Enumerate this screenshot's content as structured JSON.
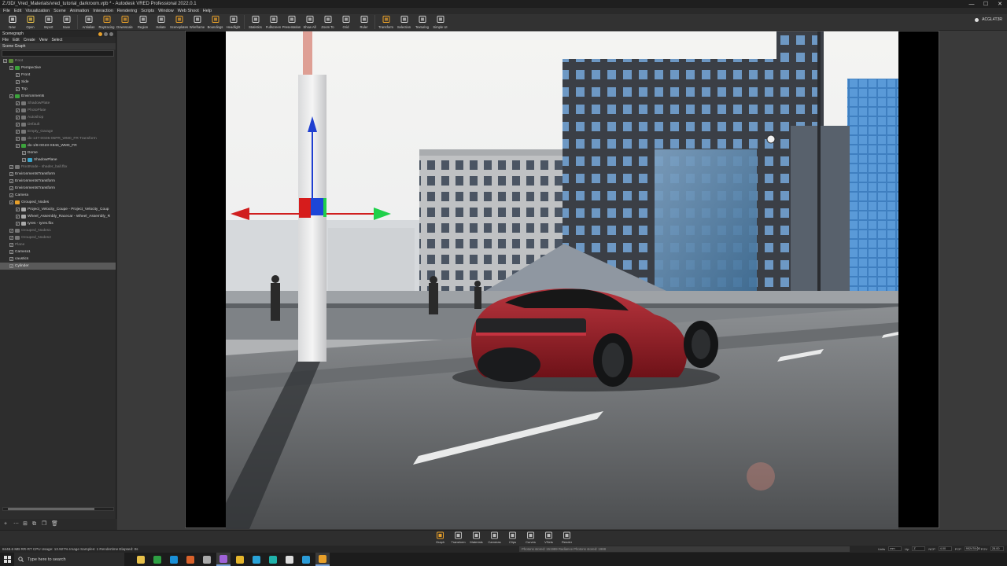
{
  "window": {
    "title": "Z:/3D/_Vred_Materials/vred_tutorial_darkroom.vpb * - Autodesk VRED Professional 2022.0.1",
    "controls": [
      "—",
      "☐",
      "✕"
    ]
  },
  "menubar": [
    "File",
    "Edit",
    "Visualization",
    "Scene",
    "Animation",
    "Interaction",
    "Rendering",
    "Scripts",
    "Window",
    "Web Shoot",
    "Help"
  ],
  "toolbar": {
    "items": [
      {
        "label": "New",
        "icon": "new-file-icon"
      },
      {
        "label": "Open",
        "icon": "open-folder-icon"
      },
      {
        "label": "Import",
        "icon": "import-icon"
      },
      {
        "label": "Save",
        "icon": "save-icon"
      },
      {
        "label": "Antialias",
        "icon": "antialias-icon"
      },
      {
        "label": "Raytracing",
        "icon": "raytracing-icon"
      },
      {
        "label": "Downscale",
        "icon": "downscale-icon"
      },
      {
        "label": "Region",
        "icon": "region-icon"
      },
      {
        "label": "Isolate",
        "icon": "isolate-icon"
      },
      {
        "label": "Sceneplates",
        "icon": "sceneplates-icon"
      },
      {
        "label": "Wireframe",
        "icon": "wireframe-icon"
      },
      {
        "label": "Boundings",
        "icon": "boundings-icon"
      },
      {
        "label": "Headlight",
        "icon": "headlight-icon"
      },
      {
        "label": "Statistics",
        "icon": "statistics-icon"
      },
      {
        "label": "Fullscreen",
        "icon": "fullscreen-icon"
      },
      {
        "label": "Presentation",
        "icon": "presentation-icon"
      },
      {
        "label": "Show All",
        "icon": "show-all-icon"
      },
      {
        "label": "Zoom To",
        "icon": "zoom-to-icon"
      },
      {
        "label": "Grid",
        "icon": "grid-icon"
      },
      {
        "label": "Ruler",
        "icon": "ruler-icon"
      },
      {
        "label": "Transform",
        "icon": "transform-icon"
      },
      {
        "label": "Selection",
        "icon": "selection-icon"
      },
      {
        "label": "Texturing",
        "icon": "texturing-icon"
      },
      {
        "label": "Simple UI",
        "icon": "simple-ui-icon"
      }
    ],
    "right_label": "ACGL4T3R"
  },
  "scenegraph": {
    "title": "Scenegraph",
    "menu": [
      "File",
      "Edit",
      "Create",
      "View",
      "Select"
    ],
    "tab": "Scene Graph",
    "search_placeholder": "",
    "nodes": [
      {
        "label": "Root",
        "depth": 0,
        "dim": true,
        "icon_color": "#5a8a3a"
      },
      {
        "label": "Perspective",
        "depth": 1,
        "dim": false,
        "icon_color": "#3ca33c"
      },
      {
        "label": "Front",
        "depth": 2,
        "dim": false,
        "icon_color": ""
      },
      {
        "label": "Side",
        "depth": 2,
        "dim": false,
        "icon_color": ""
      },
      {
        "label": "Top",
        "depth": 2,
        "dim": false,
        "icon_color": ""
      },
      {
        "label": "Environments",
        "depth": 1,
        "dim": false,
        "icon_color": "#3ca33c"
      },
      {
        "label": "ShadowPlate",
        "depth": 2,
        "dim": true,
        "icon_color": "#777"
      },
      {
        "label": "PhotoPlate",
        "depth": 2,
        "dim": true,
        "icon_color": "#777"
      },
      {
        "label": "Autoshop",
        "depth": 2,
        "dim": true,
        "icon_color": "#777"
      },
      {
        "label": "Default",
        "depth": 2,
        "dim": true,
        "icon_color": "#777"
      },
      {
        "label": "Empty_Garage",
        "depth": 2,
        "dim": true,
        "icon_color": "#777"
      },
      {
        "label": "do-137-0G05-05PR_WM0_FR Transform",
        "depth": 2,
        "dim": true,
        "icon_color": "#777"
      },
      {
        "label": "do-1/8-0G23-X846_WM0_FR",
        "depth": 2,
        "dim": false,
        "icon_color": "#3ca33c"
      },
      {
        "label": "Dome",
        "depth": 3,
        "dim": false,
        "icon_color": ""
      },
      {
        "label": "ShadowPlane",
        "depth": 3,
        "dim": false,
        "icon_color": "#3aa3c8"
      },
      {
        "label": "RootNode - shader_ball.fbx",
        "depth": 1,
        "dim": true,
        "icon_color": "#777"
      },
      {
        "label": "EnvironmentsTransform",
        "depth": 1,
        "dim": false,
        "icon_color": ""
      },
      {
        "label": "EnvironmentsTransform",
        "depth": 1,
        "dim": false,
        "icon_color": ""
      },
      {
        "label": "EnvironmentsTransform",
        "depth": 1,
        "dim": false,
        "icon_color": ""
      },
      {
        "label": "Camera",
        "depth": 1,
        "dim": false,
        "icon_color": ""
      },
      {
        "label": "Grouped_Nodes",
        "depth": 1,
        "dim": false,
        "icon_color": "#e8a02a"
      },
      {
        "label": "Project_Velocity_Coupe - Project_Velocity_Coup",
        "depth": 2,
        "dim": false,
        "icon_color": "#aaa"
      },
      {
        "label": "Wheel_Assembly_Racecar - Wheel_Assembly_R",
        "depth": 2,
        "dim": false,
        "icon_color": "#aaa"
      },
      {
        "label": "tyres - tyres.fbx",
        "depth": 2,
        "dim": false,
        "icon_color": "#aaa"
      },
      {
        "label": "Grouped_Nodes1",
        "depth": 1,
        "dim": true,
        "icon_color": "#777"
      },
      {
        "label": "Grouped_Nodes2",
        "depth": 1,
        "dim": true,
        "icon_color": "#777"
      },
      {
        "label": "Plane",
        "depth": 1,
        "dim": true,
        "icon_color": ""
      },
      {
        "label": "Camera1",
        "depth": 1,
        "dim": false,
        "icon_color": ""
      },
      {
        "label": "caustics",
        "depth": 1,
        "dim": false,
        "icon_color": ""
      },
      {
        "label": "Cylinder",
        "depth": 1,
        "dim": false,
        "selected": true,
        "icon_color": ""
      }
    ]
  },
  "dock": [
    {
      "label": "Graph",
      "icon": "graph-icon",
      "color": "#e8a02a"
    },
    {
      "label": "Transform",
      "icon": "transform-dock-icon",
      "color": "#bbb"
    },
    {
      "label": "Materials",
      "icon": "materials-icon",
      "color": "#bbb"
    },
    {
      "label": "Cameras",
      "icon": "cameras-icon",
      "color": "#bbb"
    },
    {
      "label": "Clips",
      "icon": "clips-icon",
      "color": "#bbb"
    },
    {
      "label": "Curves",
      "icon": "curves-icon",
      "color": "#bbb"
    },
    {
      "label": "VSets",
      "icon": "vsets-icon",
      "color": "#bbb"
    },
    {
      "label": "Render",
      "icon": "render-icon",
      "color": "#bbb"
    }
  ],
  "status": {
    "left": "8448.6 MB  RR-RT CPU  Usage: 13.927%  Image Samples: 1  Rendertime Elapsed: 0s",
    "middle": "Photons stored: 151989  Radiance Photons stored: 1988",
    "fields": [
      {
        "label": "Units",
        "value": "mm"
      },
      {
        "label": "Up",
        "value": "Z"
      },
      {
        "label": "NCP",
        "value": "4.00"
      },
      {
        "label": "FCP",
        "value": "952478.00"
      },
      {
        "label": "FOV",
        "value": "28.00"
      }
    ]
  },
  "taskbar": {
    "search_placeholder": "Type here to search",
    "apps": [
      {
        "name": "file-explorer-icon",
        "color": "#e8c14a",
        "active": false
      },
      {
        "name": "spreadsheet-icon",
        "color": "#2ea043",
        "active": false
      },
      {
        "name": "photo-icon",
        "color": "#1a8fd6",
        "active": false
      },
      {
        "name": "illustrator-icon",
        "color": "#d9622b",
        "active": false
      },
      {
        "name": "settings-icon",
        "color": "#aaaaaa",
        "active": false
      },
      {
        "name": "media-icon",
        "color": "#9f62d8",
        "active": true
      },
      {
        "name": "chrome-icon",
        "color": "#e6b62c",
        "active": false
      },
      {
        "name": "steam-icon",
        "color": "#29a3d8",
        "active": false
      },
      {
        "name": "terminal-icon",
        "color": "#20b2aa",
        "active": false
      },
      {
        "name": "notes-icon",
        "color": "#dddddd",
        "active": false
      },
      {
        "name": "skype-icon",
        "color": "#2b9cd8",
        "active": false
      },
      {
        "name": "vred-icon",
        "color": "#e8a02a",
        "active": true
      }
    ]
  }
}
